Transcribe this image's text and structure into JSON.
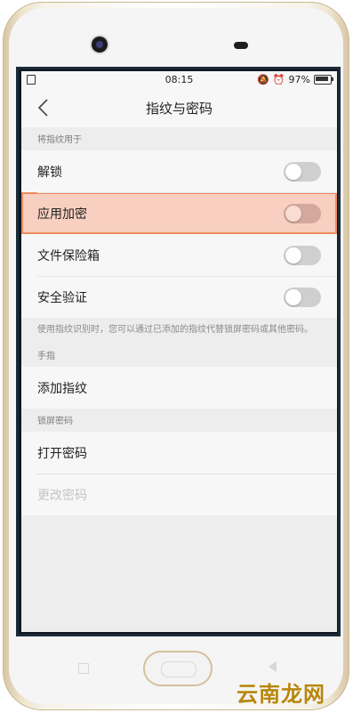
{
  "status": {
    "time": "08:15",
    "battery": "97%"
  },
  "header": {
    "title": "指纹与密码"
  },
  "fingerprint_use": {
    "label": "将指纹用于",
    "items": [
      {
        "label": "解锁"
      },
      {
        "label": "应用加密"
      },
      {
        "label": "文件保险箱"
      },
      {
        "label": "安全验证"
      }
    ],
    "note": "使用指纹识别时，您可以通过已添加的指纹代替锁屏密码或其他密码。"
  },
  "fingers": {
    "label": "手指",
    "add": "添加指纹"
  },
  "lock": {
    "label": "锁屏密码",
    "open": "打开密码",
    "change": "更改密码"
  },
  "watermark": "云南龙网"
}
